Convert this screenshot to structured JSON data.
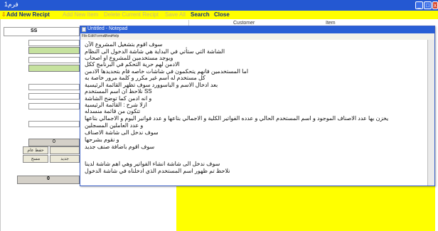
{
  "app": {
    "title": "فرم1",
    "minimize": "_",
    "maximize": "□",
    "close": "x"
  },
  "menu": [
    {
      "label": "Add New Recipt",
      "enabled": true
    },
    {
      "label": "Add New Item",
      "enabled": false
    },
    {
      "label": "Delete Current Recipt",
      "enabled": false
    },
    {
      "label": "Save All",
      "enabled": false
    },
    {
      "label": "Search",
      "enabled": true
    },
    {
      "label": "Close",
      "enabled": true
    }
  ],
  "grid": {
    "columns": [
      "Customer",
      "Item"
    ]
  },
  "left": {
    "ss_label": "SS",
    "total_value": "0",
    "bottom_value": "0",
    "btn_save_general": "حفظ عام",
    "btn_delete": "مسح",
    "btn_new": "جديد"
  },
  "notepad": {
    "title": "Untitled - Notepad",
    "menu": [
      "File",
      "Edit",
      "Format",
      "View",
      "Help"
    ],
    "lines": [
      "سوف اقوم بتشغيل المشروع الآن",
      "الشاشة التي ستأتي في البداية هي شاشة الدخول الى النظام",
      "ويوجد مستخدمين للمشروع او اصحاب",
      "الادمن لهم حرية التحكم في البرنامج ككل",
      "اما المستخدمين فانهم يتحكمون في شاشات خاصه قام بتحديدها الادمن",
      "كل مستخدم له اسم غير مكرر و كلمة مرور خاصة به",
      "بعد ادخال الاسم و الباسوورد سوف تظهر القائمة الرئيسية",
      "SS نلاحظ ان اسم المستخدم",
      "و انه ادمن كما توضح الشاشة",
      "ازلا شرح : القائمة الرئيسية",
      "تتكون من قائمة منسدله",
      "يخزن بها عدد الاصناف الموجود و اسم المستخدم الحالي و عدده الفواتير الكلية و الاجمالي بتاعها و عدد فواتير اليوم و الاجمالي بتاعها",
      "و عدد العاملين المسجلين",
      "سوف ندخل الى شاشة الاصناف",
      "و نقوم بشرحها",
      "سوف اقوم باضافة صنف جديد",
      "",
      "سوف ندخل الى شاشة انشاء  الفواتير وهي اهم شاشة لدينا",
      "نلاحظ تم ظهور اسم المستخدم الذي ادخلناه في شاشة الدخول"
    ]
  }
}
